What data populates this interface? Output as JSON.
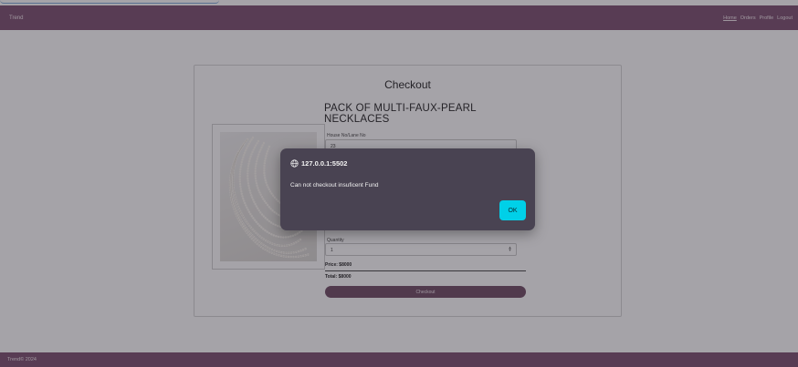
{
  "navbar": {
    "brand": "Trend",
    "links": [
      "Home",
      "Orders",
      "Profile",
      "Logout"
    ]
  },
  "checkout": {
    "title": "Checkout",
    "product_name": "PACK OF MULTI-FAUX-PEARL NECKLACES",
    "address_label": "House No/Lane No",
    "address_value": "23",
    "quantity_label": "Quantity",
    "quantity_value": "1",
    "price": "Price: $8000",
    "total": "Total: $8000",
    "checkout_button": "Checkout"
  },
  "footer": {
    "text": "Trend© 2024"
  },
  "dialog": {
    "origin": "127.0.0.1:5502",
    "message": "Can not checkout insuficent Fund",
    "ok_label": "OK"
  },
  "colors": {
    "navbar": "#7b4e6e",
    "checkout_button": "#6e4a62",
    "dialog_background": "#494352",
    "ok_button": "#00d0e8"
  },
  "icons": [
    "globe-icon",
    "stepper-arrows-icon"
  ]
}
